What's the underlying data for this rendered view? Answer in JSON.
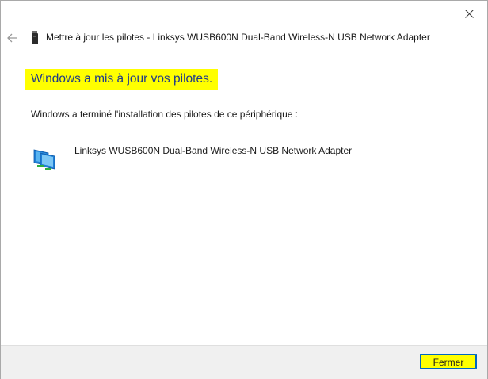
{
  "window": {
    "title": "Mettre à jour les pilotes - Linksys WUSB600N Dual-Band Wireless-N USB Network Adapter"
  },
  "content": {
    "heading": "Windows a mis à jour vos pilotes.",
    "subtext": "Windows a terminé l'installation des pilotes de ce périphérique :",
    "device_name": "Linksys WUSB600N Dual-Band Wireless-N USB Network Adapter"
  },
  "footer": {
    "close_label": "Fermer"
  },
  "colors": {
    "highlight": "#ffff00",
    "heading_text": "#1f3a8a",
    "button_border": "#0067c0"
  },
  "icons": {
    "back": "back-arrow-icon",
    "close": "close-icon",
    "usb_device": "usb-device-icon",
    "network_adapter": "network-adapter-icon"
  }
}
